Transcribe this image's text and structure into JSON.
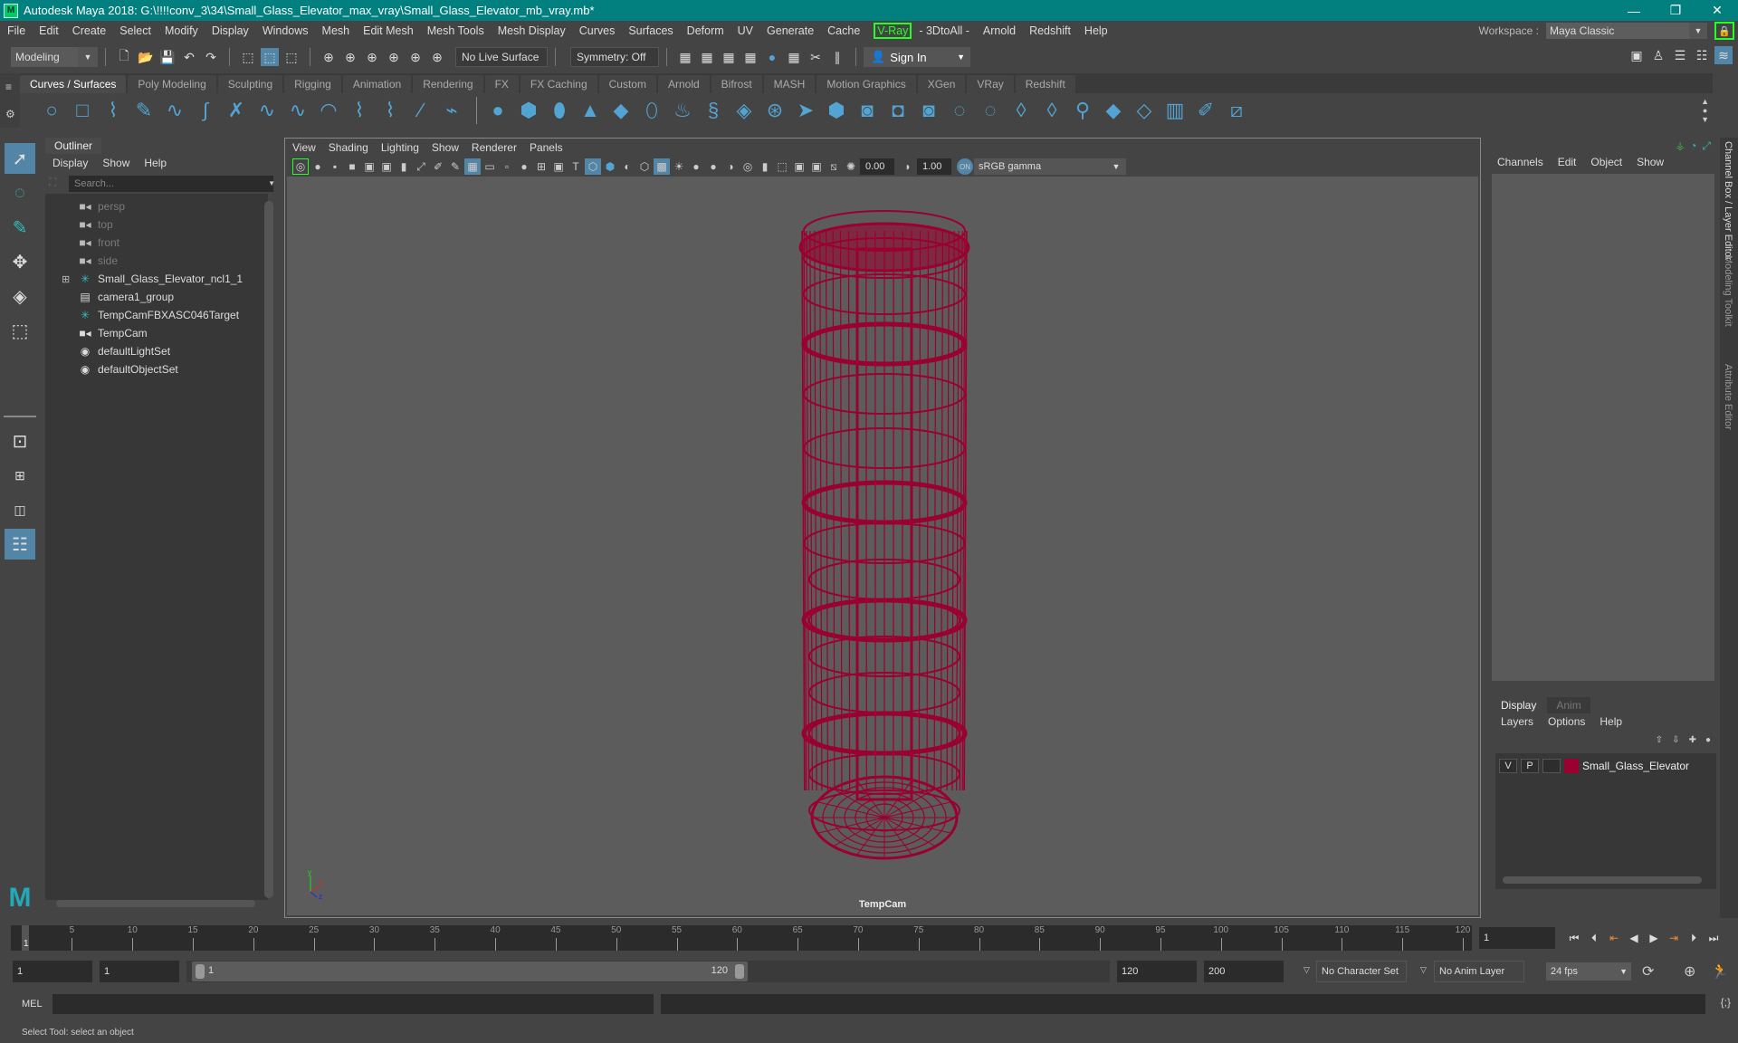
{
  "title": "Autodesk Maya 2018: G:\\!!!!conv_3\\34\\Small_Glass_Elevator_max_vray\\Small_Glass_Elevator_mb_vray.mb*",
  "window_controls": {
    "minimize": "—",
    "restore": "❐",
    "close": "✕"
  },
  "menubar": [
    "File",
    "Edit",
    "Create",
    "Select",
    "Modify",
    "Display",
    "Windows",
    "Mesh",
    "Edit Mesh",
    "Mesh Tools",
    "Mesh Display",
    "Curves",
    "Surfaces",
    "Deform",
    "UV",
    "Generate",
    "Cache",
    "V-Ray",
    "- 3DtoAll -",
    "Arnold",
    "Redshift",
    "Help"
  ],
  "workspace": {
    "label": "Workspace :",
    "value": "Maya Classic"
  },
  "statusline": {
    "menuset": "Modeling",
    "live_surface": "No Live Surface",
    "symmetry": "Symmetry: Off",
    "sign_in": "Sign In"
  },
  "shelf_tabs": [
    "Curves / Surfaces",
    "Poly Modeling",
    "Sculpting",
    "Rigging",
    "Animation",
    "Rendering",
    "FX",
    "FX Caching",
    "Custom",
    "Arnold",
    "Bifrost",
    "MASH",
    "Motion Graphics",
    "XGen",
    "VRay",
    "Redshift"
  ],
  "shelf_active": "Curves / Surfaces",
  "outliner": {
    "title": "Outliner",
    "menu": [
      "Display",
      "Show",
      "Help"
    ],
    "search_placeholder": "Search...",
    "items": [
      {
        "label": "persp",
        "icon": "camera-icon",
        "dim": true
      },
      {
        "label": "top",
        "icon": "camera-icon",
        "dim": true
      },
      {
        "label": "front",
        "icon": "camera-icon",
        "dim": true
      },
      {
        "label": "side",
        "icon": "camera-icon",
        "dim": true
      },
      {
        "label": "Small_Glass_Elevator_ncl1_1",
        "icon": "locator-icon",
        "expandable": true
      },
      {
        "label": "camera1_group",
        "icon": "group-icon"
      },
      {
        "label": "TempCamFBXASC046Target",
        "icon": "locator-icon"
      },
      {
        "label": "TempCam",
        "icon": "camera-icon"
      },
      {
        "label": "defaultLightSet",
        "icon": "set-icon"
      },
      {
        "label": "defaultObjectSet",
        "icon": "set-icon"
      }
    ]
  },
  "viewport": {
    "menu": [
      "View",
      "Shading",
      "Lighting",
      "Show",
      "Renderer",
      "Panels"
    ],
    "exposure": "0.00",
    "gamma": "1.00",
    "colorspace": "sRGB gamma",
    "camera_label": "TempCam",
    "axis": {
      "x": "x",
      "y": "y",
      "z": "z"
    },
    "wire_color": "#9a0030"
  },
  "channel_box": {
    "menu": [
      "Channels",
      "Edit",
      "Object",
      "Show"
    ],
    "layer_tabs": [
      "Display",
      "Anim"
    ],
    "layer_menu": [
      "Layers",
      "Options",
      "Help"
    ],
    "layers": [
      {
        "v": "V",
        "p": "P",
        "name": "Small_Glass_Elevator",
        "color": "#9a0030"
      }
    ]
  },
  "side_tabs": [
    "Channel Box / Layer Editor",
    "Modeling Toolkit",
    "Attribute Editor"
  ],
  "timeline": {
    "ticks": [
      "5",
      "10",
      "15",
      "20",
      "25",
      "30",
      "35",
      "40",
      "45",
      "50",
      "55",
      "60",
      "65",
      "70",
      "75",
      "80",
      "85",
      "90",
      "95",
      "100",
      "105",
      "110",
      "115",
      "120"
    ],
    "current_frame": "1",
    "current_frame_field": "1"
  },
  "range": {
    "start": "1",
    "anim_start": "1",
    "range_start": "1",
    "range_end": "120",
    "end": "120",
    "anim_end": "200",
    "character_set": "No Character Set",
    "anim_layer": "No Anim Layer",
    "fps": "24 fps"
  },
  "cmdline": {
    "label": "MEL"
  },
  "helpline": "Select Tool: select an object"
}
